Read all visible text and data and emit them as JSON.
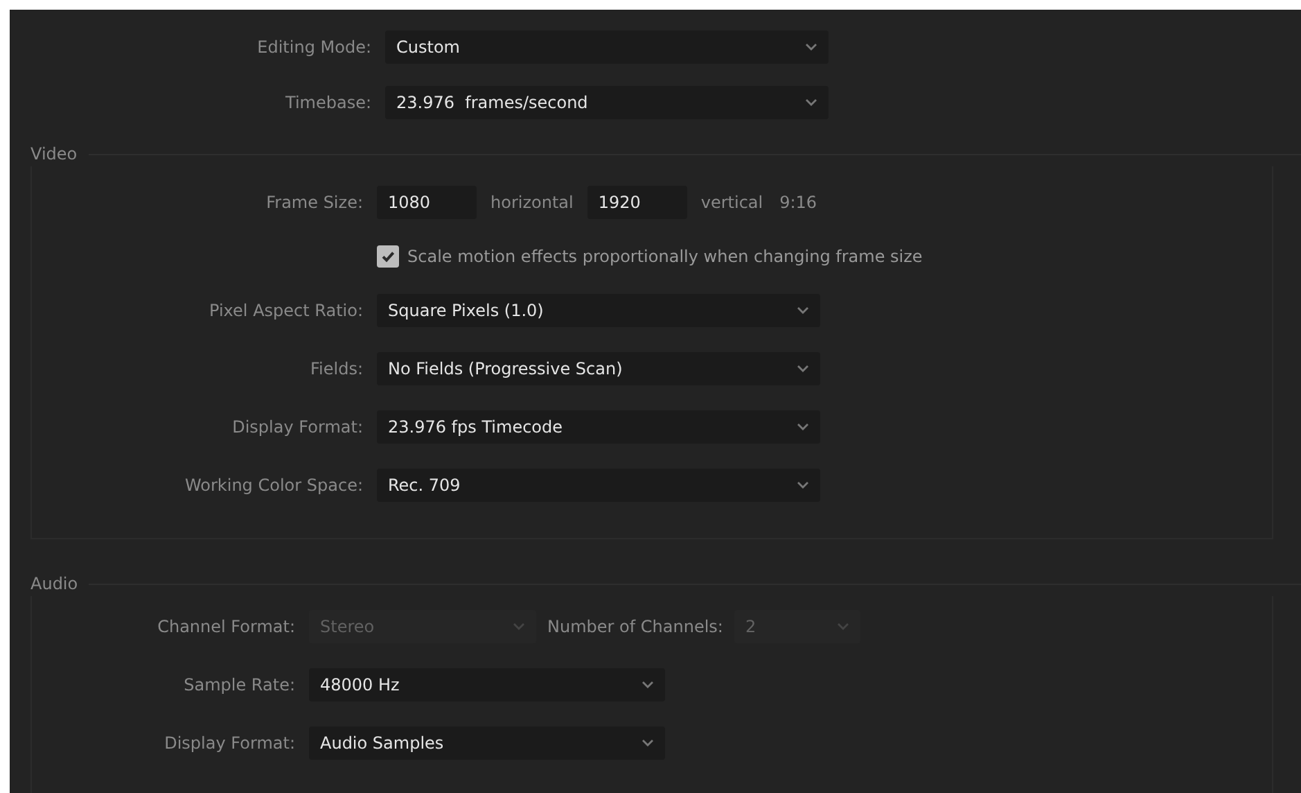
{
  "general": [
    {
      "kind": "select",
      "label": "Editing Mode:",
      "value": "Custom",
      "disabled": false
    },
    {
      "kind": "select",
      "label": "Timebase:",
      "value": "23.976  frames/second",
      "disabled": false
    }
  ],
  "video": {
    "title": "Video",
    "rows": [
      {
        "kind": "frame_size",
        "label": "Frame Size:",
        "horizontal_value": "1080",
        "horizontal_label": "horizontal",
        "vertical_value": "1920",
        "vertical_label": "vertical",
        "ratio": "9:16"
      },
      {
        "kind": "checkbox",
        "label": "Scale motion effects proportionally when changing frame size",
        "checked": true
      },
      {
        "kind": "select",
        "label": "Pixel Aspect Ratio:",
        "value": "Square Pixels (1.0)",
        "disabled": false
      },
      {
        "kind": "select",
        "label": "Fields:",
        "value": "No Fields (Progressive Scan)",
        "disabled": false
      },
      {
        "kind": "select",
        "label": "Display Format:",
        "value": "23.976 fps Timecode",
        "disabled": false
      },
      {
        "kind": "select",
        "label": "Working Color Space:",
        "value": "Rec. 709",
        "disabled": false
      }
    ]
  },
  "audio": {
    "title": "Audio",
    "rows": [
      {
        "kind": "channel",
        "label": "Channel Format:",
        "value": "Stereo",
        "disabled": true,
        "channels_label": "Number of Channels:",
        "channels_value": "2",
        "channels_disabled": true
      },
      {
        "kind": "select",
        "label": "Sample Rate:",
        "value": "48000 Hz",
        "disabled": false
      },
      {
        "kind": "select",
        "label": "Display Format:",
        "value": "Audio Samples",
        "disabled": false
      }
    ]
  }
}
